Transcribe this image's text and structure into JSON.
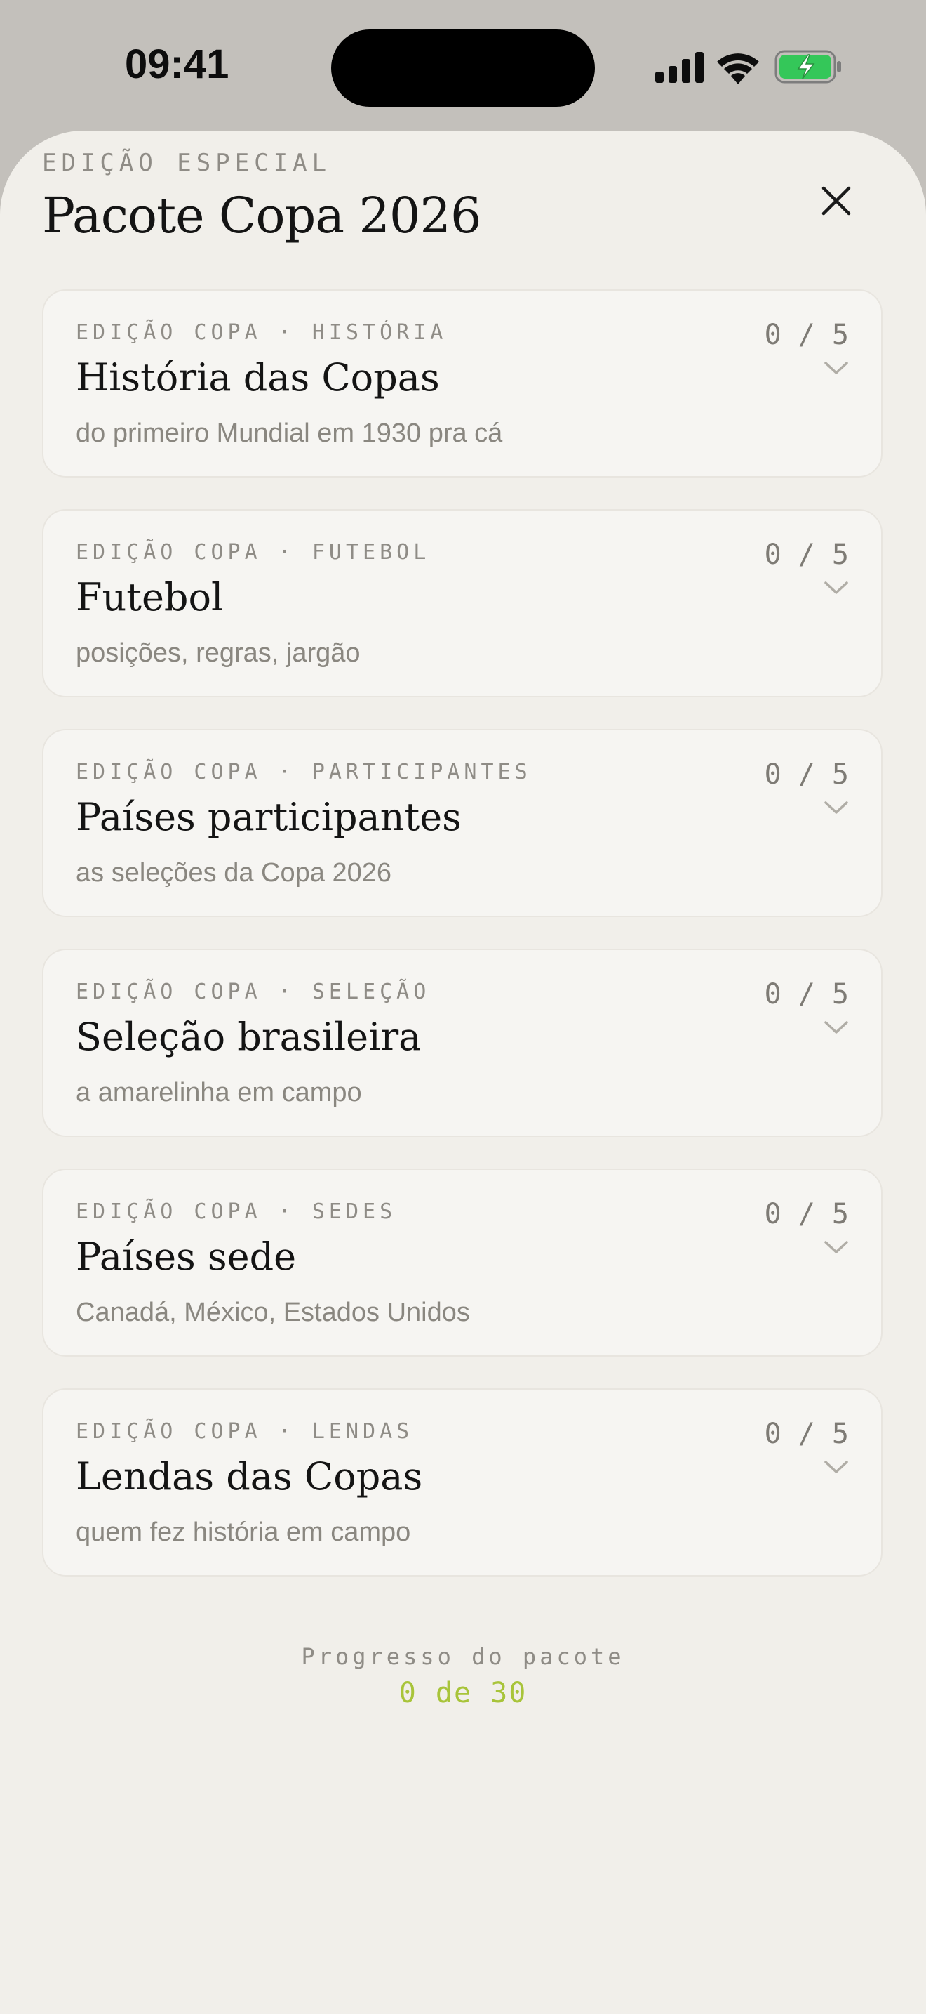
{
  "status_bar": {
    "time": "09:41",
    "icons": [
      "signal-icon",
      "wifi-icon",
      "battery-charging-icon"
    ],
    "battery_color": "#34c759"
  },
  "sheet": {
    "eyebrow": "EDIÇÃO ESPECIAL",
    "title": "Pacote Copa 2026",
    "close_icon": "close-icon"
  },
  "cards": [
    {
      "eyebrow": "EDIÇÃO COPA · HISTÓRIA",
      "title": "História das Copas",
      "subtitle": "do primeiro Mundial em 1930 pra cá",
      "count": "0 / 5"
    },
    {
      "eyebrow": "EDIÇÃO COPA · FUTEBOL",
      "title": "Futebol",
      "subtitle": "posições, regras, jargão",
      "count": "0 / 5"
    },
    {
      "eyebrow": "EDIÇÃO COPA · PARTICIPANTES",
      "title": "Países participantes",
      "subtitle": "as seleções da Copa 2026",
      "count": "0 / 5"
    },
    {
      "eyebrow": "EDIÇÃO COPA · SELEÇÃO",
      "title": "Seleção brasileira",
      "subtitle": "a amarelinha em campo",
      "count": "0 / 5"
    },
    {
      "eyebrow": "EDIÇÃO COPA · SEDES",
      "title": "Países sede",
      "subtitle": "Canadá, México, Estados Unidos",
      "count": "0 / 5"
    },
    {
      "eyebrow": "EDIÇÃO COPA · LENDAS",
      "title": "Lendas das Copas",
      "subtitle": "quem fez história em campo",
      "count": "0 / 5"
    }
  ],
  "progress": {
    "label": "Progresso do pacote",
    "value": "0 de 30",
    "accent_color": "#a8c43a"
  }
}
